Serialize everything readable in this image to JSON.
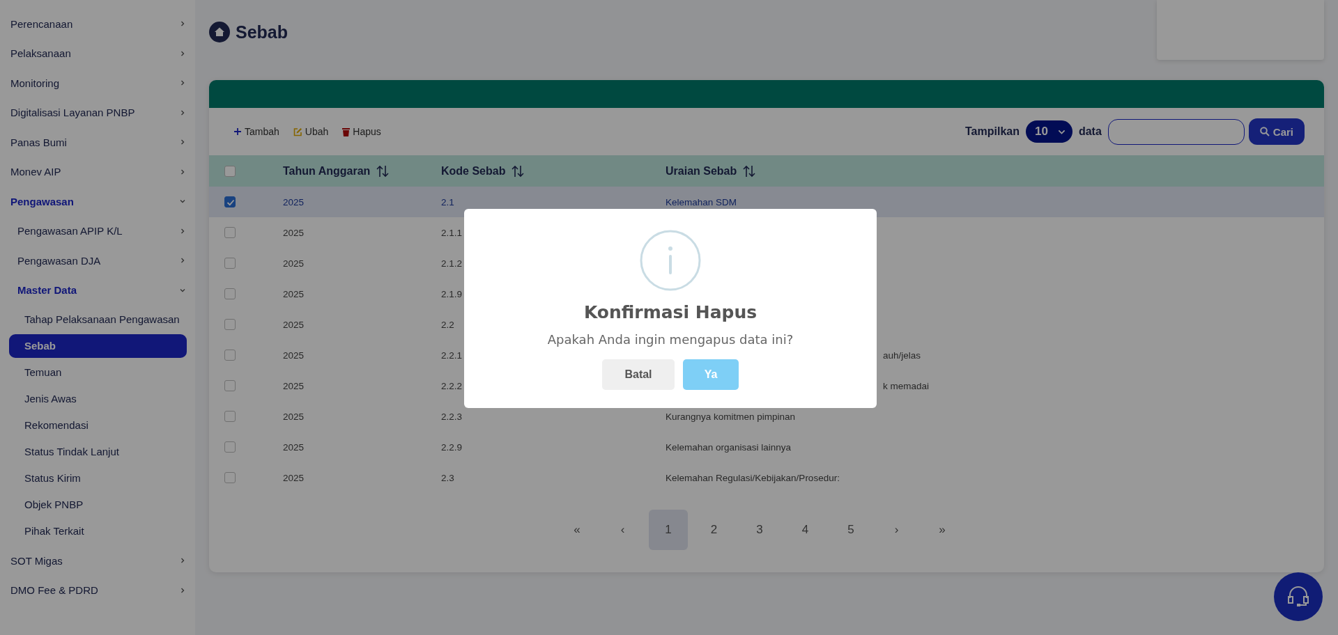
{
  "sidebar": {
    "items": [
      {
        "label": "Perencanaan",
        "expanded": false
      },
      {
        "label": "Pelaksanaan",
        "expanded": false
      },
      {
        "label": "Monitoring",
        "expanded": false
      },
      {
        "label": "Digitalisasi Layanan PNBP",
        "expanded": false
      },
      {
        "label": "Panas Bumi",
        "expanded": false
      },
      {
        "label": "Monev AIP",
        "expanded": false
      },
      {
        "label": "Pengawasan",
        "expanded": true,
        "children": [
          {
            "label": "Pengawasan APIP K/L",
            "expanded": false
          },
          {
            "label": "Pengawasan DJA",
            "expanded": false
          },
          {
            "label": "Master Data",
            "expanded": true,
            "children": [
              {
                "label": "Tahap Pelaksanaan Pengawasan",
                "selected": false
              },
              {
                "label": "Sebab",
                "selected": true
              },
              {
                "label": "Temuan",
                "selected": false
              },
              {
                "label": "Jenis Awas",
                "selected": false
              },
              {
                "label": "Rekomendasi",
                "selected": false
              },
              {
                "label": "Status Tindak Lanjut",
                "selected": false
              },
              {
                "label": "Status Kirim",
                "selected": false
              },
              {
                "label": "Objek PNBP",
                "selected": false
              },
              {
                "label": "Pihak Terkait",
                "selected": false
              }
            ]
          }
        ]
      },
      {
        "label": "SOT Migas",
        "expanded": false
      },
      {
        "label": "DMO Fee & PDRD",
        "expanded": false
      }
    ]
  },
  "page": {
    "title": "Sebab"
  },
  "toolbar": {
    "actions": [
      {
        "kind": "add",
        "label": "Tambah"
      },
      {
        "kind": "edit",
        "label": "Ubah"
      },
      {
        "kind": "delete",
        "label": "Hapus"
      }
    ],
    "page_size": {
      "label": "Tampilkan",
      "value": "10",
      "suffix": "data"
    },
    "search": {
      "button": "Cari"
    }
  },
  "table": {
    "header_checked": false,
    "columns": [
      "Tahun Anggaran",
      "Kode Sebab",
      "Uraian Sebab"
    ],
    "rows": [
      {
        "checked": true,
        "year": "2025",
        "code": "2.1",
        "description": "Kelemahan SDM"
      },
      {
        "checked": false,
        "year": "2025",
        "code": "2.1.1"
      },
      {
        "checked": false,
        "year": "2025",
        "code": "2.1.2"
      },
      {
        "checked": false,
        "year": "2025",
        "code": "2.1.9"
      },
      {
        "checked": false,
        "year": "2025",
        "code": "2.2"
      },
      {
        "checked": false,
        "year": "2025",
        "code": "2.2.1",
        "description": "auh/jelas",
        "kind": "cut"
      },
      {
        "checked": false,
        "year": "2025",
        "code": "2.2.2",
        "description": "k memadai",
        "kind": "cut"
      },
      {
        "checked": false,
        "year": "2025",
        "code": "2.2.3",
        "description": "Kurangnya komitmen pimpinan"
      },
      {
        "checked": false,
        "year": "2025",
        "code": "2.2.9",
        "description": "Kelemahan organisasi lainnya"
      },
      {
        "checked": false,
        "year": "2025",
        "code": "2.3",
        "description": "Kelemahan Regulasi/Kebijakan/Prosedur:"
      }
    ]
  },
  "pagination": {
    "first": "«",
    "prev": "‹",
    "pages": [
      {
        "label": "1",
        "selected": true
      },
      {
        "label": "2",
        "selected": false
      },
      {
        "label": "3",
        "selected": false
      },
      {
        "label": "4",
        "selected": false
      },
      {
        "label": "5",
        "selected": false
      }
    ],
    "next": "›",
    "last": "»"
  },
  "dialog": {
    "title": "Konfirmasi Hapus",
    "message": "Apakah Anda ingin mengapus data ini?",
    "buttons": [
      {
        "kind": "cancel",
        "label": "Batal"
      },
      {
        "kind": "confirm",
        "label": "Ya"
      }
    ]
  }
}
